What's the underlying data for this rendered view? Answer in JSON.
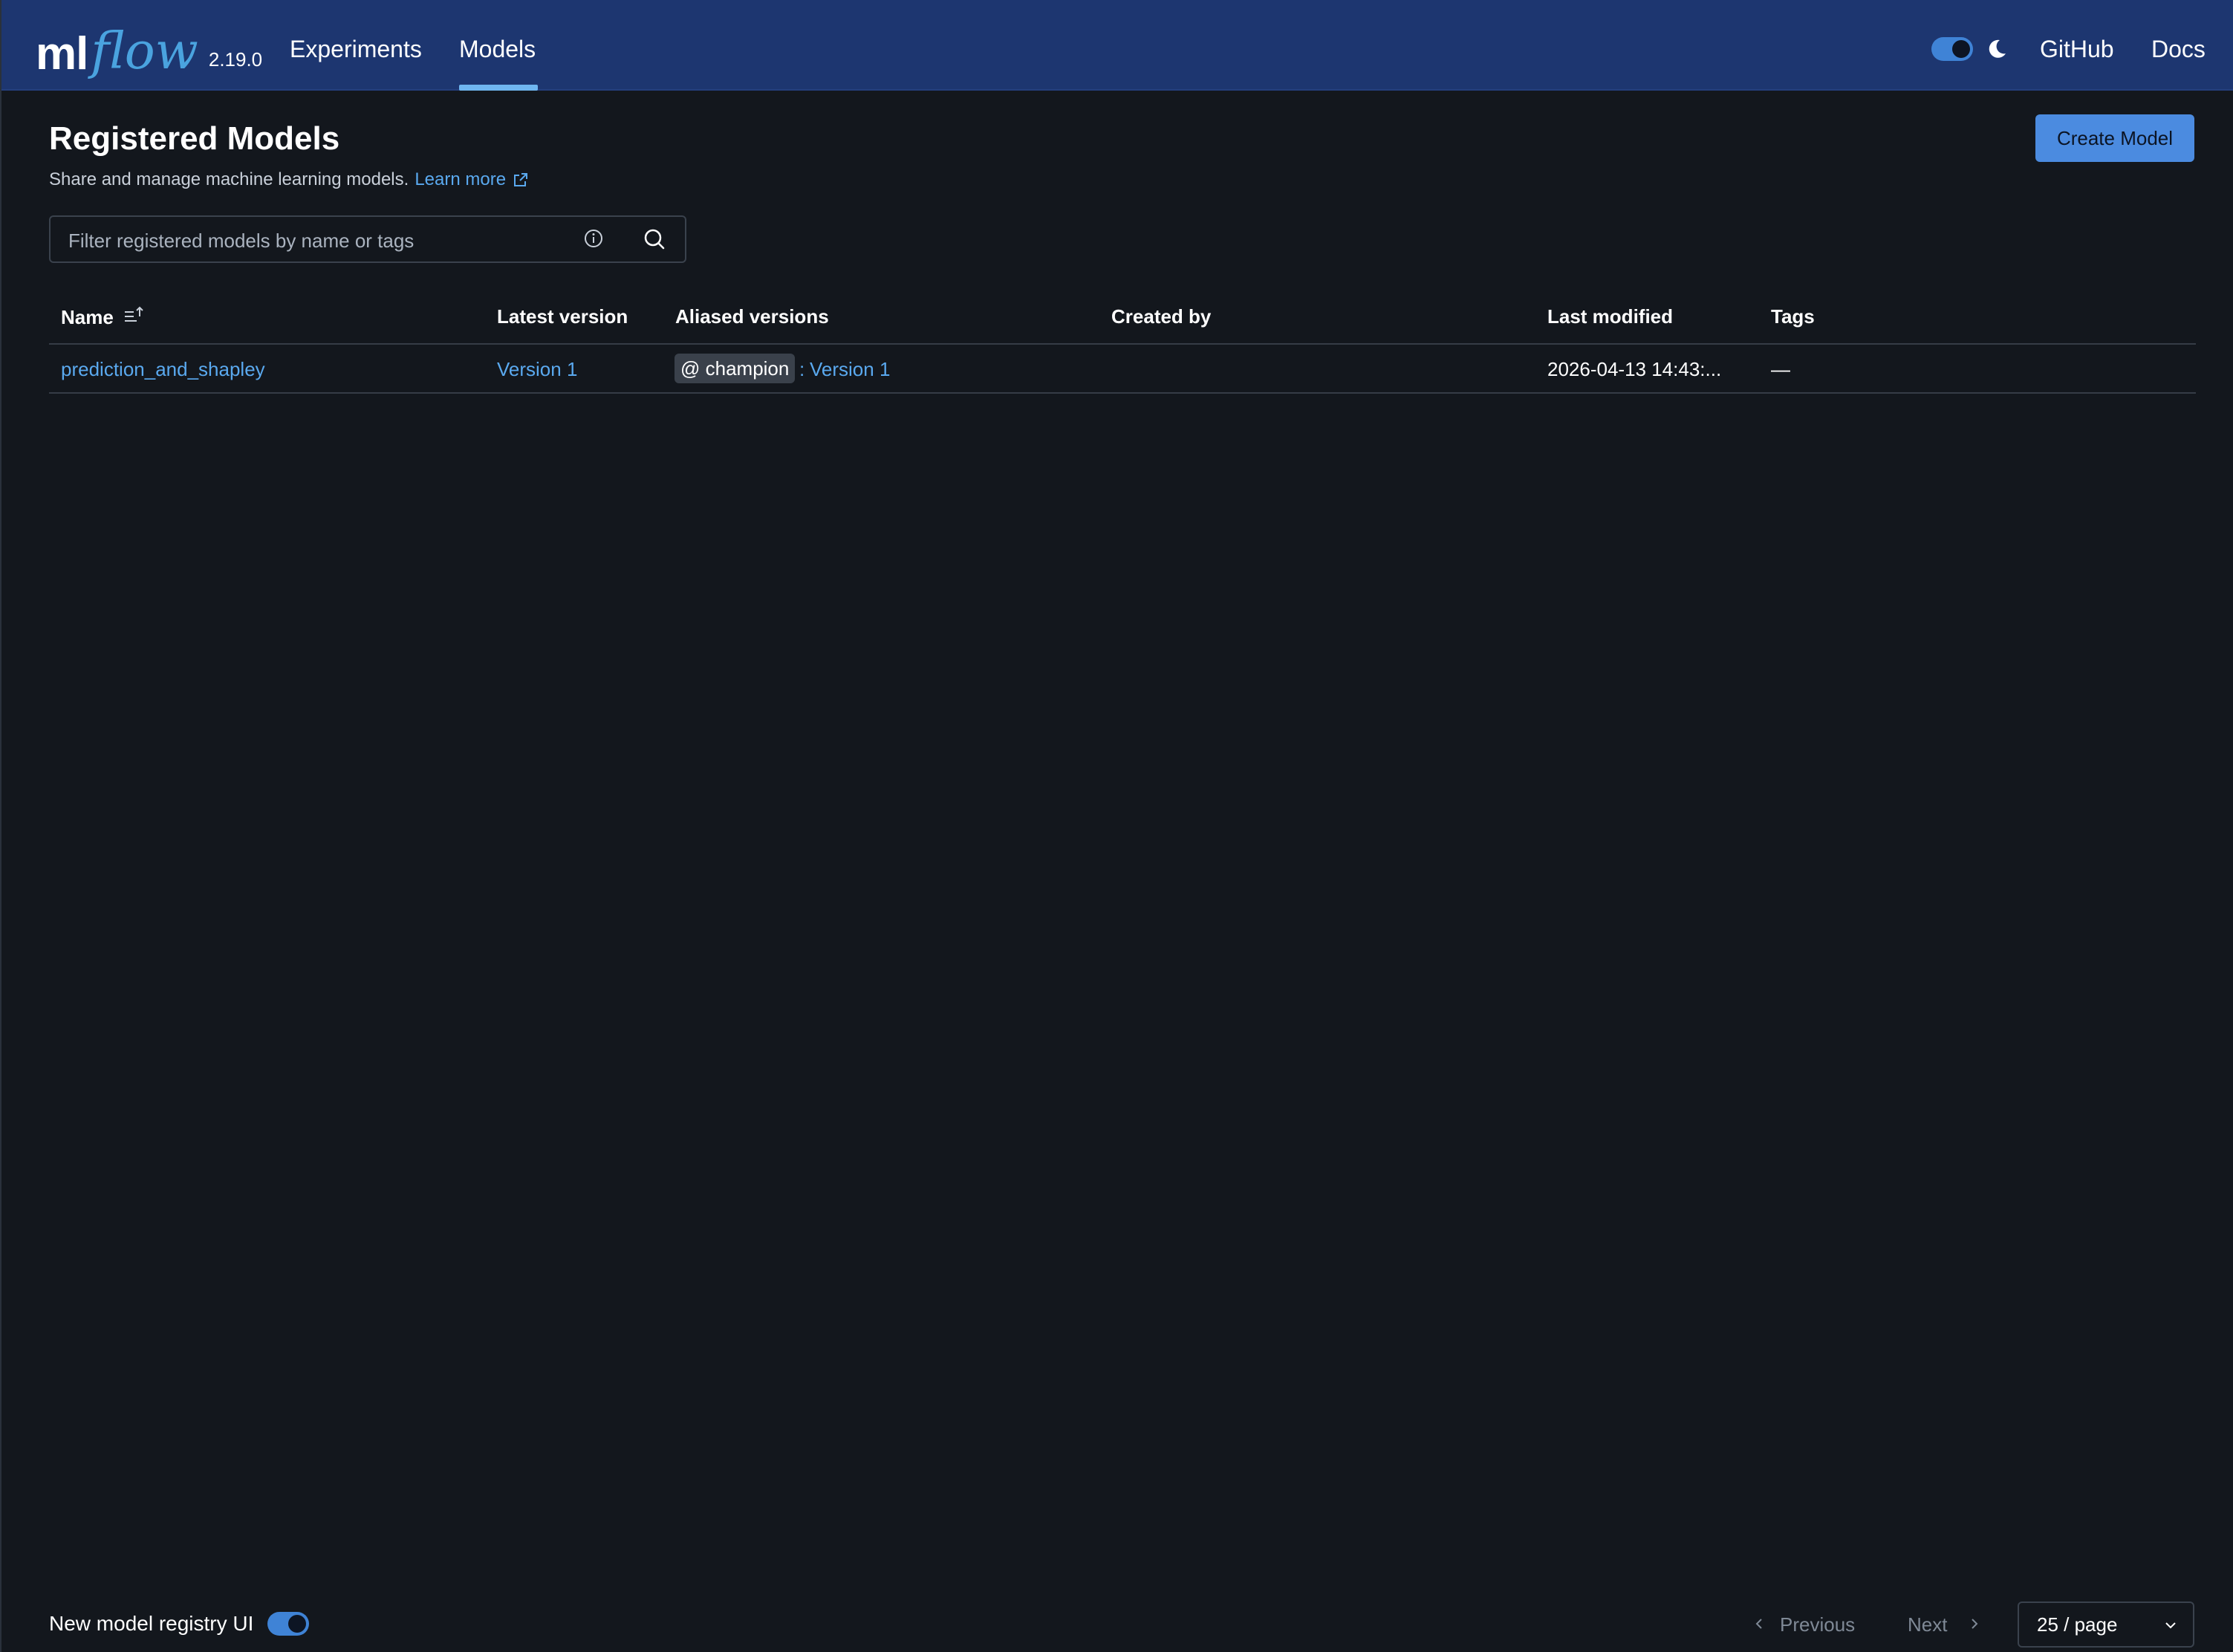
{
  "app": {
    "logo_ml": "ml",
    "logo_flow": "flow",
    "version": "2.19.0"
  },
  "nav": {
    "experiments": "Experiments",
    "models": "Models",
    "github": "GitHub",
    "docs": "Docs"
  },
  "page": {
    "title": "Registered Models",
    "subtitle": "Share and manage machine learning models.",
    "learn_more": "Learn more",
    "create_button": "Create Model"
  },
  "search": {
    "placeholder": "Filter registered models by name or tags"
  },
  "table": {
    "columns": [
      "Name",
      "Latest version",
      "Aliased versions",
      "Created by",
      "Last modified",
      "Tags"
    ],
    "rows": [
      {
        "name": "prediction_and_shapley",
        "latest_version": "Version 1",
        "alias": "@ champion",
        "alias_sep": ":",
        "alias_version": "Version 1",
        "created_by": "",
        "last_modified": "2026-04-13 14:43:...",
        "tags": "—"
      }
    ]
  },
  "footer": {
    "toggle_label": "New model registry UI",
    "previous": "Previous",
    "next": "Next",
    "page_size": "25 / page"
  },
  "colors": {
    "header_bg": "#1d3670",
    "page_bg": "#13171d",
    "accent": "#4b8be0",
    "link": "#5aa9ef"
  }
}
